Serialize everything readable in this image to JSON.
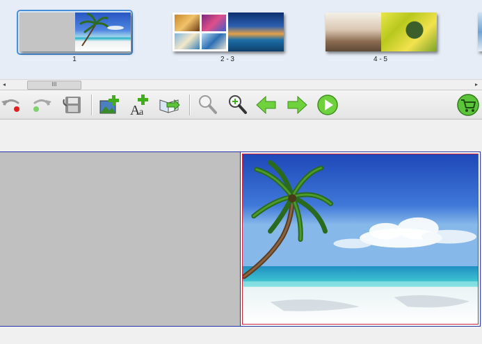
{
  "thumbnails": [
    {
      "label": "1",
      "selected": true,
      "pages": [
        "blank",
        "beach"
      ]
    },
    {
      "label": "2 - 3",
      "selected": false,
      "pages": [
        "collage",
        "venice"
      ]
    },
    {
      "label": "4 - 5",
      "selected": false,
      "pages": [
        "people",
        "flowers"
      ]
    }
  ],
  "scrollbar": {
    "left_arrow": "◂",
    "right_arrow": "▸",
    "thumb_grip": "III"
  },
  "toolbar": {
    "buttons": [
      {
        "name": "undo-button",
        "icon": "undo-icon"
      },
      {
        "name": "redo-button",
        "icon": "redo-icon"
      },
      {
        "name": "save-button",
        "icon": "save-icon"
      },
      {
        "name": "add-photo-button",
        "icon": "add-photo-icon"
      },
      {
        "name": "add-text-button",
        "icon": "add-text-icon"
      },
      {
        "name": "add-page-button",
        "icon": "add-page-icon"
      },
      {
        "name": "zoom-out-button",
        "icon": "zoom-out-icon"
      },
      {
        "name": "zoom-in-button",
        "icon": "zoom-in-icon"
      },
      {
        "name": "previous-page-button",
        "icon": "arrow-left-icon"
      },
      {
        "name": "next-page-button",
        "icon": "arrow-right-icon"
      },
      {
        "name": "play-preview-button",
        "icon": "play-icon"
      },
      {
        "name": "cart-button",
        "icon": "shopping-cart-icon"
      }
    ]
  },
  "colors": {
    "selection_border": "#4a90d9",
    "spread_border": "#2233aa",
    "photo_frame_border": "#d0203a",
    "green_accent": "#3fae1a"
  }
}
